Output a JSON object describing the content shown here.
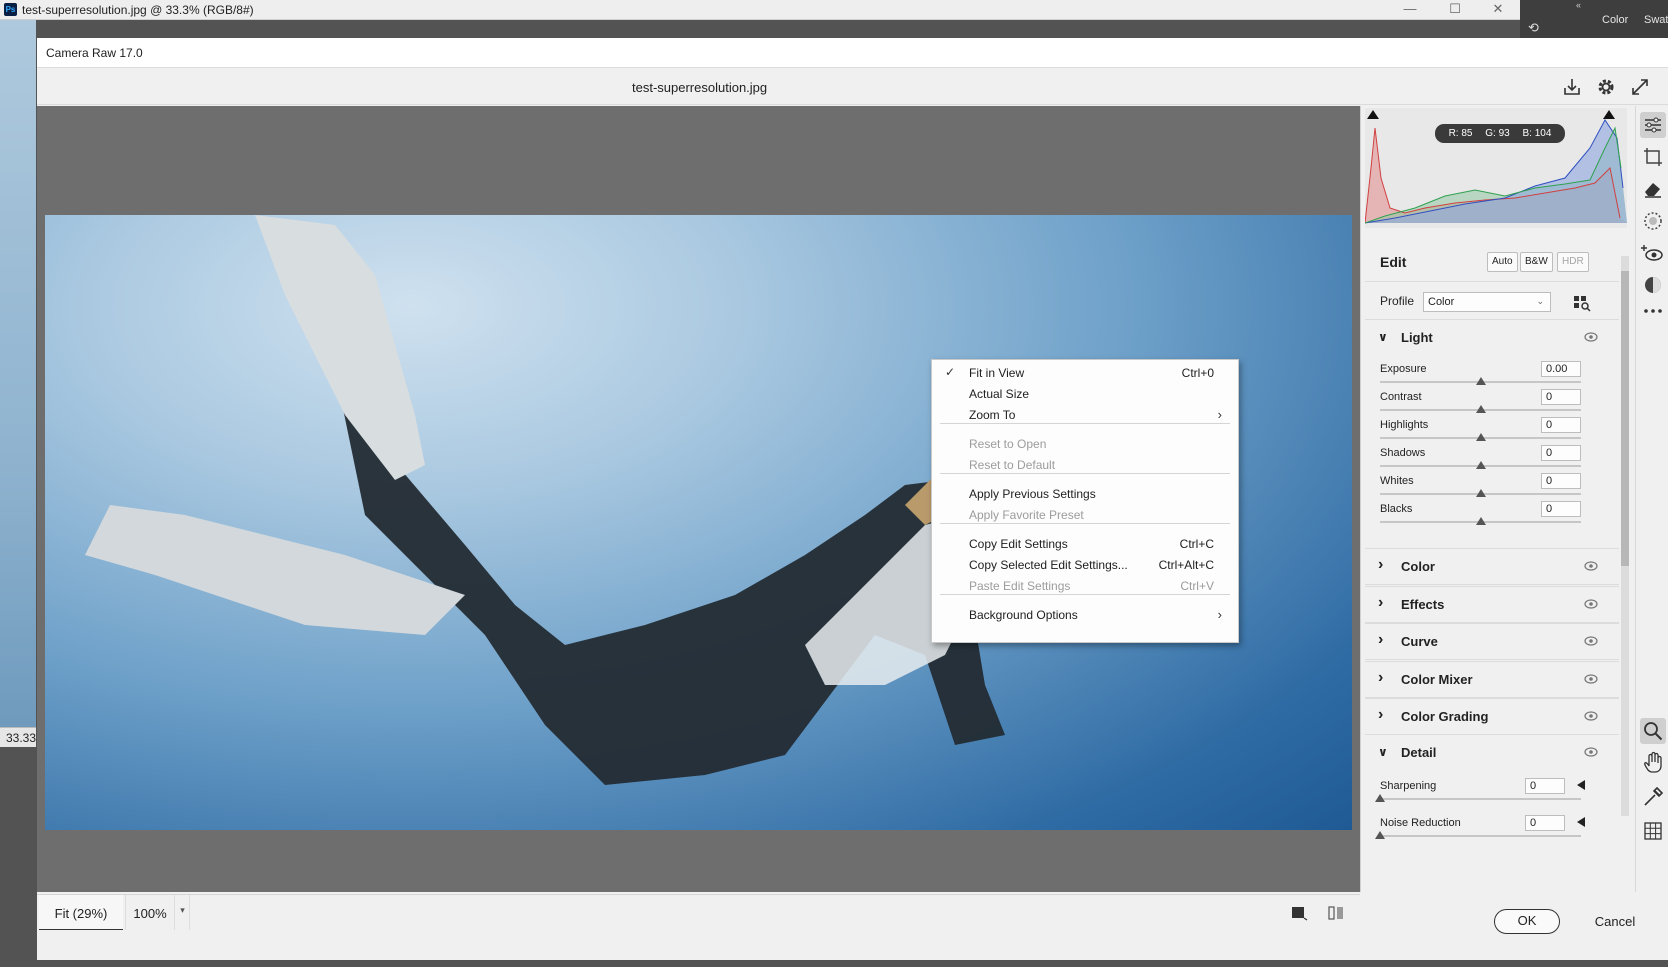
{
  "photoshop": {
    "window_title": "test-superresolution.jpg @ 33.3% (RGB/8#)",
    "zoom_label": "33.33",
    "right_tabs": [
      "Color",
      "Swat"
    ],
    "logo": "Ps"
  },
  "camera_raw": {
    "title": "Camera Raw 17.0",
    "filename": "test-superresolution.jpg",
    "header_icons": [
      "save-image-icon",
      "gear-icon",
      "fullscreen-icon"
    ]
  },
  "histogram": {
    "readout": {
      "r": "R: 85",
      "g": "G: 93",
      "b": "B: 104"
    }
  },
  "edit": {
    "title": "Edit",
    "buttons": {
      "auto": "Auto",
      "bw": "B&W",
      "hdr": "HDR"
    },
    "profile_label": "Profile",
    "profile_value": "Color"
  },
  "light": {
    "title": "Light",
    "sliders": [
      {
        "label": "Exposure",
        "value": "0.00",
        "level": 0.5
      },
      {
        "label": "Contrast",
        "value": "0",
        "level": 0.5
      },
      {
        "label": "Highlights",
        "value": "0",
        "level": 0.5
      },
      {
        "label": "Shadows",
        "value": "0",
        "level": 0.5
      },
      {
        "label": "Whites",
        "value": "0",
        "level": 0.5
      },
      {
        "label": "Blacks",
        "value": "0",
        "level": 0.5
      }
    ]
  },
  "sections": [
    {
      "title": "Color",
      "expanded": false
    },
    {
      "title": "Effects",
      "expanded": false
    },
    {
      "title": "Curve",
      "expanded": false
    },
    {
      "title": "Color Mixer",
      "expanded": false
    },
    {
      "title": "Color Grading",
      "expanded": false
    }
  ],
  "detail": {
    "title": "Detail",
    "sliders": [
      {
        "label": "Sharpening",
        "value": "0",
        "level": 0
      },
      {
        "label": "Noise Reduction",
        "value": "0",
        "level": 0
      }
    ]
  },
  "statusbar": {
    "fit": "Fit (29%)",
    "zoom": "100%"
  },
  "footer": {
    "ok": "OK",
    "cancel": "Cancel"
  },
  "context_menu": {
    "items": [
      {
        "label": "Fit in View",
        "shortcut": "Ctrl+0",
        "checked": true,
        "enabled": true
      },
      {
        "label": "Actual Size",
        "shortcut": "",
        "enabled": true
      },
      {
        "label": "Zoom To",
        "submenu": true,
        "enabled": true
      },
      {
        "label": "Reset to Open",
        "enabled": false
      },
      {
        "label": "Reset to Default",
        "enabled": false
      },
      {
        "label": "Apply Previous Settings",
        "enabled": true
      },
      {
        "label": "Apply Favorite Preset",
        "enabled": false
      },
      {
        "label": "Copy Edit Settings",
        "shortcut": "Ctrl+C",
        "enabled": true
      },
      {
        "label": "Copy Selected Edit Settings...",
        "shortcut": "Ctrl+Alt+C",
        "enabled": true
      },
      {
        "label": "Paste Edit Settings",
        "shortcut": "Ctrl+V",
        "enabled": false
      },
      {
        "label": "Background Options",
        "submenu": true,
        "enabled": true
      }
    ],
    "check_glyph": "✓",
    "submenu_glyph": "›"
  },
  "tools": [
    "edit-icon",
    "crop-icon",
    "eraser-icon",
    "masking-icon",
    "red-eye-icon",
    "presets-icon",
    "more-icon",
    "zoom-icon",
    "hand-icon",
    "sampler-icon",
    "grid-icon"
  ]
}
